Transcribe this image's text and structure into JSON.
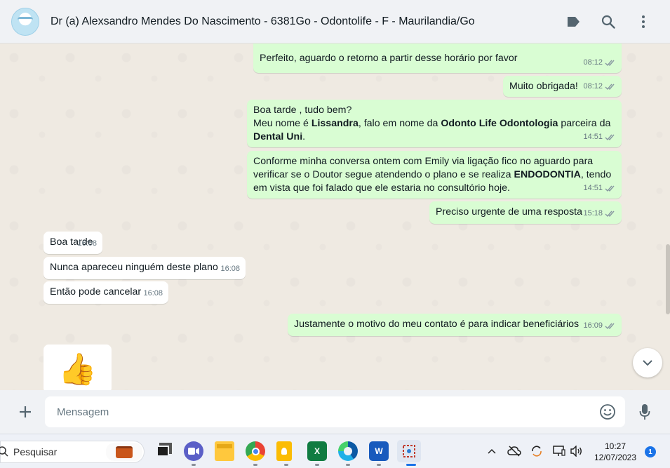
{
  "header": {
    "title": "Dr (a) Alexsandro Mendes Do Nascimento - 6381Go - Odontolife - F - Maurilandia/Go",
    "icons": [
      "label-icon",
      "search-icon",
      "menu-icon"
    ]
  },
  "messages": [
    {
      "dir": "out",
      "text": "Perfeito, aguardo o retorno a partir desse horário por favor",
      "time": "08:12"
    },
    {
      "dir": "out",
      "text": "Muito obrigada!",
      "time": "08:12"
    },
    {
      "dir": "out",
      "parts": {
        "line1": "Boa tarde , tudo bem?",
        "l2a": "Meu nome é ",
        "l2b": "Lissandra",
        "l2c": ", falo em nome da ",
        "l2d": "Odonto Life Odontologia",
        "l2e": " parceira da",
        "l3a": "Dental Uni",
        "l3b": "."
      },
      "time": "14:51"
    },
    {
      "dir": "out",
      "parts": {
        "a": "Conforme minha conversa ontem com Emily via ligação fico no aguardo para verificar se o Doutor segue atendendo o plano e se realiza ",
        "b": "ENDODONTIA",
        "c": ", tendo em vista que foi falado que ele estaria no consultório hoje."
      },
      "time": "14:51"
    },
    {
      "dir": "out",
      "text": "Preciso urgente de uma resposta",
      "time": "15:18"
    },
    {
      "dir": "in",
      "text": "Boa tarde",
      "time": "16:08"
    },
    {
      "dir": "in",
      "text": "Nunca apareceu ninguém deste plano",
      "time": "16:08"
    },
    {
      "dir": "in",
      "text": "Então pode cancelar",
      "time": "16:08"
    },
    {
      "dir": "out",
      "text": "Justamente o motivo do meu contato é para indicar beneficiários",
      "time": "16:09"
    },
    {
      "dir": "in",
      "emoji": "👍"
    }
  ],
  "composer": {
    "placeholder": "Mensagem"
  },
  "taskbar": {
    "search_label": "Pesquisar",
    "time": "10:27",
    "date": "12/07/2023",
    "notifications": "1",
    "apps": [
      "work-briefcase-icon",
      "task-view-icon",
      "meet-icon",
      "file-explorer-icon",
      "chrome-icon",
      "keep-icon",
      "excel-icon",
      "edge-icon",
      "word-icon",
      "snipping-tool-icon"
    ]
  },
  "colors": {
    "outgoing_bubble": "#d9fdd3",
    "incoming_bubble": "#ffffff",
    "chat_background": "#efeae2",
    "header_background": "#f0f2f5",
    "meta_text": "#667781"
  }
}
